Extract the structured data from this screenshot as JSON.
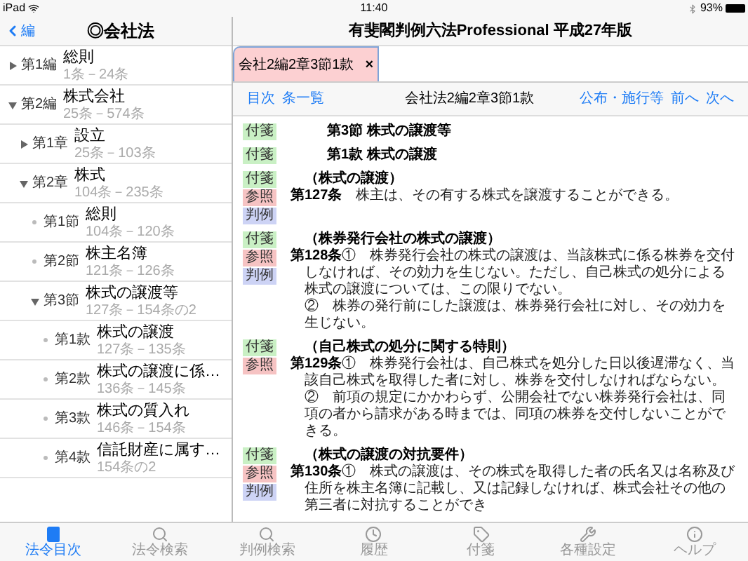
{
  "status_bar": {
    "device": "iPad",
    "time": "11:40",
    "battery": "93%"
  },
  "sidebar": {
    "back_label": "編",
    "title": "◎会社法",
    "tree": [
      {
        "label": "第1編",
        "title": "総則",
        "range": "1条－24条",
        "expanded": false
      },
      {
        "label": "第2編",
        "title": "株式会社",
        "range": "25条－574条",
        "expanded": true,
        "children": [
          {
            "label": "第1章",
            "title": "設立",
            "range": "25条－103条",
            "expanded": false
          },
          {
            "label": "第2章",
            "title": "株式",
            "range": "104条－235条",
            "expanded": true,
            "children": [
              {
                "label": "第1節",
                "title": "総則",
                "range": "104条－120条"
              },
              {
                "label": "第2節",
                "title": "株主名簿",
                "range": "121条－126条"
              },
              {
                "label": "第3節",
                "title": "株式の譲渡等",
                "range": "127条－154条の2",
                "expanded": true,
                "children": [
                  {
                    "label": "第1款",
                    "title": "株式の譲渡",
                    "range": "127条－135条"
                  },
                  {
                    "label": "第2款",
                    "title": "株式の譲渡に係…",
                    "range": "136条－145条"
                  },
                  {
                    "label": "第3款",
                    "title": "株式の質入れ",
                    "range": "146条－154条"
                  },
                  {
                    "label": "第4款",
                    "title": "信託財産に属す…",
                    "range": "154条の2"
                  }
                ]
              }
            ]
          }
        ]
      }
    ]
  },
  "header": {
    "title": "有斐閣判例六法Professional 平成27年版"
  },
  "tabs": [
    {
      "label": "会社2編2章3節1款",
      "close": "×",
      "selected": true
    }
  ],
  "toolbar": {
    "left": [
      "目次",
      "条一覧"
    ],
    "title": "会社法2編2章3節1款",
    "right": [
      "公布・施行等",
      "前へ",
      "次へ"
    ]
  },
  "content": [
    {
      "kind": "heading",
      "badges": [
        {
          "label": "付箋",
          "color": "#c9f0c4"
        }
      ],
      "text": "第3節 株式の譲渡等"
    },
    {
      "kind": "heading",
      "badges": [
        {
          "label": "付箋",
          "color": "#c9f0c4"
        }
      ],
      "text": "第1款 株式の譲渡"
    },
    {
      "kind": "article",
      "badges": [
        {
          "label": "付箋",
          "color": "#c9f0c4"
        },
        {
          "label": "参照",
          "color": "#f6c3c3"
        },
        {
          "label": "判例",
          "color": "#cdd3f5"
        }
      ],
      "caption": "（株式の譲渡）",
      "number": "第127条",
      "paragraphs": [
        {
          "text": "株主は、その有する株式を譲渡することができる。"
        }
      ]
    },
    {
      "kind": "article",
      "badges": [
        {
          "label": "付箋",
          "color": "#c9f0c4"
        },
        {
          "label": "参照",
          "color": "#f6c3c3"
        },
        {
          "label": "判例",
          "color": "#cdd3f5"
        }
      ],
      "caption": "（株券発行会社の株式の譲渡）",
      "number": "第128条",
      "paragraphs": [
        {
          "mark": "①",
          "text": "株券発行会社の株式の譲渡は、当該株式に係る株券を交付しなければ、その効力を生じない。ただし、自己株式の処分による株式の譲渡については、この限りでない。"
        },
        {
          "mark": "②",
          "text": "株券の発行前にした譲渡は、株券発行会社に対し、その効力を生じない。"
        }
      ]
    },
    {
      "kind": "article",
      "badges": [
        {
          "label": "付箋",
          "color": "#c9f0c4"
        },
        {
          "label": "参照",
          "color": "#f6c3c3"
        }
      ],
      "caption": "（自己株式の処分に関する特則）",
      "number": "第129条",
      "paragraphs": [
        {
          "mark": "①",
          "text": "株券発行会社は、自己株式を処分した日以後遅滞なく、当該自己株式を取得した者に対し、株券を交付しなければならない。"
        },
        {
          "mark": "②",
          "text": "前項の規定にかかわらず、公開会社でない株券発行会社は、同項の者から請求がある時までは、同項の株券を交付しないことができる。"
        }
      ]
    },
    {
      "kind": "article",
      "badges": [
        {
          "label": "付箋",
          "color": "#c9f0c4"
        },
        {
          "label": "参照",
          "color": "#f6c3c3"
        },
        {
          "label": "判例",
          "color": "#cdd3f5"
        }
      ],
      "caption": "（株式の譲渡の対抗要件）",
      "number": "第130条",
      "paragraphs": [
        {
          "mark": "①",
          "text": "株式の譲渡は、その株式を取得した者の氏名又は名称及び住所を株主名簿に記載し、又は記録しなければ、株式会社その他の第三者に対抗することができ"
        }
      ]
    }
  ],
  "tab_bar": [
    {
      "kind": "book",
      "label": "法令目次",
      "selected": true
    },
    {
      "kind": "search",
      "label": "法令検索",
      "selected": false
    },
    {
      "kind": "search",
      "label": "判例検索",
      "selected": false
    },
    {
      "kind": "history",
      "label": "履歴",
      "selected": false
    },
    {
      "kind": "tag",
      "label": "付箋",
      "selected": false
    },
    {
      "kind": "settings",
      "label": "各種設定",
      "selected": false
    },
    {
      "kind": "help",
      "label": "ヘルプ",
      "selected": false
    }
  ]
}
